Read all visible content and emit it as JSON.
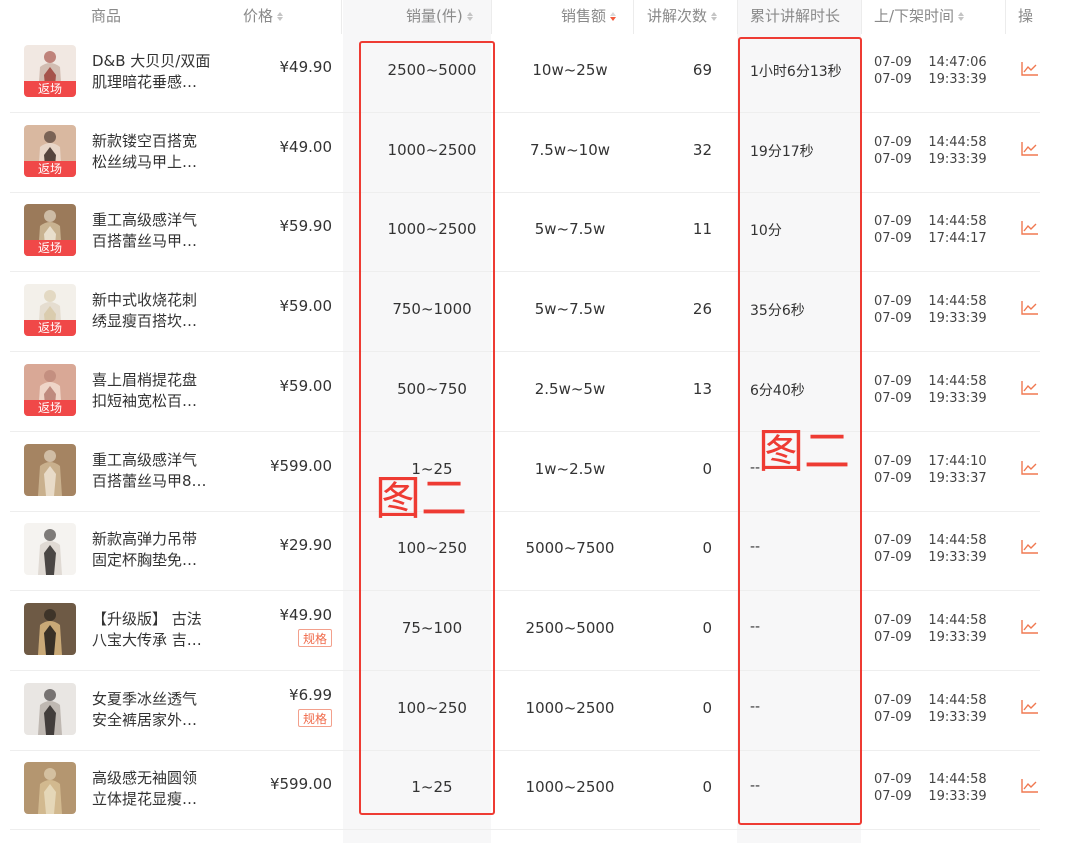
{
  "header": {
    "product": "商品",
    "price": "价格",
    "sales": "销量(件)",
    "amount": "销售额",
    "explain_times": "讲解次数",
    "explain_duration": "累计讲解时长",
    "shelf_time": "上/下架时间",
    "operation": "操"
  },
  "sort_active_column": "amount",
  "tags": {
    "return": "返场",
    "spec": "规格"
  },
  "annotations": {
    "left_label": "图二",
    "right_label": "图二"
  },
  "colors": {
    "accent": "#f25a3c",
    "annotation_red": "#ee3b33",
    "return_tag": "#f04848",
    "chart_icon": "#f07850"
  },
  "rows": [
    {
      "name_line1": "D&B 大贝贝/双面",
      "name_line2": "肌理暗花垂感…",
      "price": "¥49.90",
      "return_tag": true,
      "spec_tag": false,
      "sales": "2500~5000",
      "amount": "10w~25w",
      "explain_times": "69",
      "explain_duration": "1小时6分13秒",
      "on_date": "07-09",
      "on_time": "14:47:06",
      "off_date": "07-09",
      "off_time": "19:33:39",
      "thumb_colors": [
        "#f1e8e2",
        "#9e4037",
        "#d2bdb2"
      ],
      "op_icon": "trend-chart-icon"
    },
    {
      "name_line1": "新款镂空百搭宽",
      "name_line2": "松丝绒马甲上…",
      "price": "¥49.00",
      "return_tag": true,
      "spec_tag": false,
      "sales": "1000~2500",
      "amount": "7.5w~10w",
      "explain_times": "32",
      "explain_duration": "19分17秒",
      "on_date": "07-09",
      "on_time": "14:44:58",
      "off_date": "07-09",
      "off_time": "19:33:39",
      "thumb_colors": [
        "#d9b8a0",
        "#3a2a24",
        "#e8d6c8"
      ],
      "op_icon": "trend-chart-icon"
    },
    {
      "name_line1": "重工高级感洋气",
      "name_line2": "百搭蕾丝马甲…",
      "price": "¥59.90",
      "return_tag": true,
      "spec_tag": false,
      "sales": "1000~2500",
      "amount": "5w~7.5w",
      "explain_times": "11",
      "explain_duration": "10分",
      "on_date": "07-09",
      "on_time": "14:44:58",
      "off_date": "07-09",
      "off_time": "17:44:17",
      "thumb_colors": [
        "#9b7a5a",
        "#efe6d6",
        "#c9b391"
      ],
      "op_icon": "trend-chart-icon"
    },
    {
      "name_line1": "新中式收烧花刺",
      "name_line2": "绣显瘦百搭坎…",
      "price": "¥59.00",
      "return_tag": true,
      "spec_tag": false,
      "sales": "750~1000",
      "amount": "5w~7.5w",
      "explain_times": "26",
      "explain_duration": "35分6秒",
      "on_date": "07-09",
      "on_time": "14:44:58",
      "off_date": "07-09",
      "off_time": "19:33:39",
      "thumb_colors": [
        "#f3f0ea",
        "#d8c9a8",
        "#e5ddd0"
      ],
      "op_icon": "trend-chart-icon"
    },
    {
      "name_line1": "喜上眉梢提花盘",
      "name_line2": "扣短袖宽松百…",
      "price": "¥59.00",
      "return_tag": true,
      "spec_tag": false,
      "sales": "500~750",
      "amount": "2.5w~5w",
      "explain_times": "13",
      "explain_duration": "6分40秒",
      "on_date": "07-09",
      "on_time": "14:44:58",
      "off_date": "07-09",
      "off_time": "19:33:39",
      "thumb_colors": [
        "#d9a896",
        "#b67e72",
        "#efd5c8"
      ],
      "op_icon": "trend-chart-icon"
    },
    {
      "name_line1": "重工高级感洋气",
      "name_line2": "百搭蕾丝马甲8…",
      "price": "¥599.00",
      "return_tag": false,
      "spec_tag": false,
      "sales": "1~25",
      "amount": "1w~2.5w",
      "explain_times": "0",
      "explain_duration": "--",
      "on_date": "07-09",
      "on_time": "17:44:10",
      "off_date": "07-09",
      "off_time": "19:33:37",
      "thumb_colors": [
        "#a58462",
        "#ede3d2",
        "#c9b08d"
      ],
      "op_icon": "trend-chart-icon"
    },
    {
      "name_line1": "新款高弹力吊带",
      "name_line2": "固定杯胸垫免…",
      "price": "¥29.90",
      "return_tag": false,
      "spec_tag": false,
      "sales": "100~250",
      "amount": "5000~7500",
      "explain_times": "0",
      "explain_duration": "--",
      "on_date": "07-09",
      "on_time": "14:44:58",
      "off_date": "07-09",
      "off_time": "19:33:39",
      "thumb_colors": [
        "#f5f3f0",
        "#2f2b2a",
        "#e0dad4"
      ],
      "op_icon": "trend-chart-icon"
    },
    {
      "name_line1": "【升级版】 古法",
      "name_line2": "八宝大传承 吉…",
      "price": "¥49.90",
      "return_tag": false,
      "spec_tag": true,
      "sales": "75~100",
      "amount": "2500~5000",
      "explain_times": "0",
      "explain_duration": "--",
      "on_date": "07-09",
      "on_time": "14:44:58",
      "off_date": "07-09",
      "off_time": "19:33:39",
      "thumb_colors": [
        "#6e5a45",
        "#1e1b17",
        "#c9a977"
      ],
      "op_icon": "trend-chart-icon"
    },
    {
      "name_line1": "女夏季冰丝透气",
      "name_line2": "安全裤居家外…",
      "price": "¥6.99",
      "return_tag": false,
      "spec_tag": true,
      "sales": "100~250",
      "amount": "1000~2500",
      "explain_times": "0",
      "explain_duration": "--",
      "on_date": "07-09",
      "on_time": "14:44:58",
      "off_date": "07-09",
      "off_time": "19:33:39",
      "thumb_colors": [
        "#e9e6e3",
        "#2b2726",
        "#bfb8b2"
      ],
      "op_icon": "trend-chart-icon"
    },
    {
      "name_line1": "高级感无袖圆领",
      "name_line2": "立体提花显瘦…",
      "price": "¥599.00",
      "return_tag": false,
      "spec_tag": false,
      "sales": "1~25",
      "amount": "1000~2500",
      "explain_times": "0",
      "explain_duration": "--",
      "on_date": "07-09",
      "on_time": "14:44:58",
      "off_date": "07-09",
      "off_time": "19:33:39",
      "thumb_colors": [
        "#b49670",
        "#e9dcc0",
        "#d2b98f"
      ],
      "op_icon": "trend-chart-icon"
    }
  ]
}
